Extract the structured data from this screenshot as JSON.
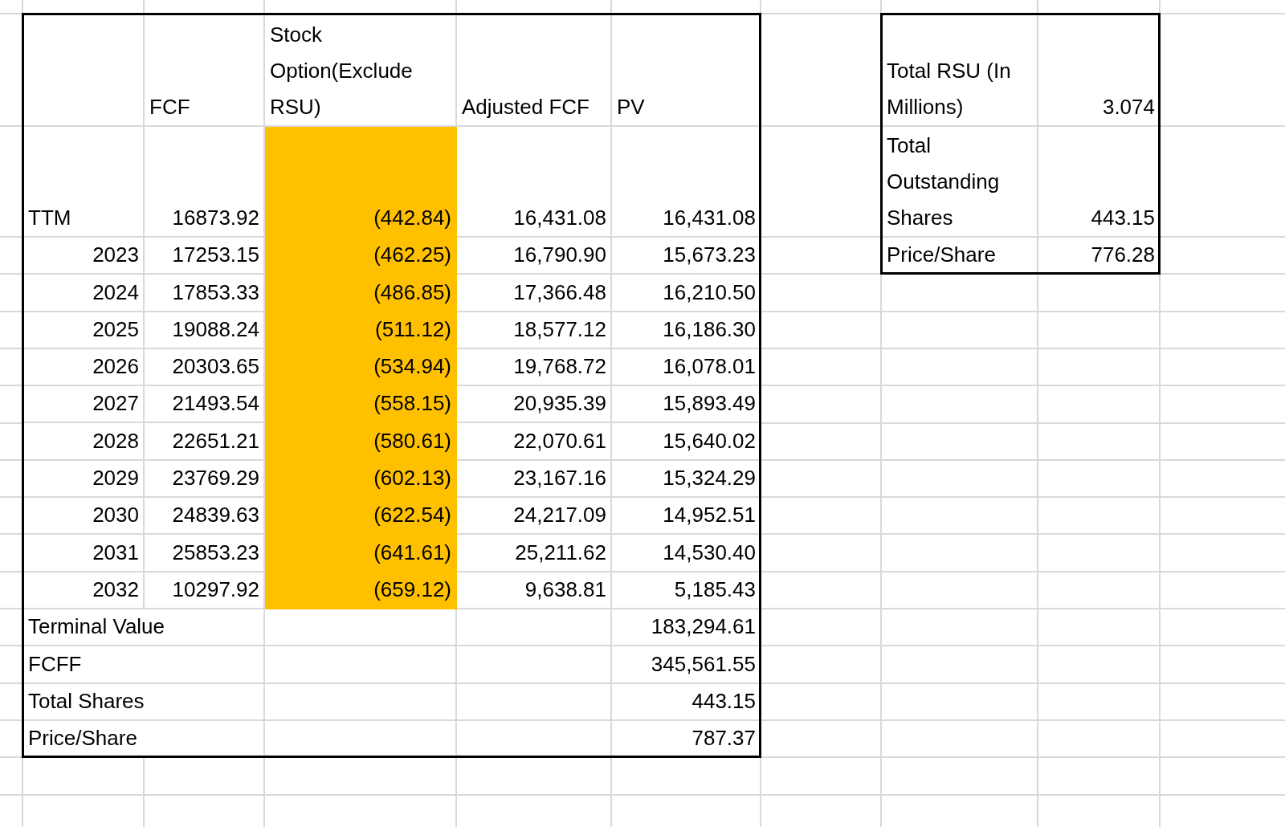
{
  "main_table": {
    "headers": [
      {
        "text": "FCF"
      },
      {
        "text": "Stock Option(Exclude RSU)"
      },
      {
        "text": "Adjusted FCF"
      },
      {
        "text": "PV"
      }
    ],
    "rows": [
      {
        "kind": "text",
        "label": "TTM",
        "fcf": "16873.92",
        "stock_option": "(442.84)",
        "stock_option_highlighted": true,
        "adjusted_fcf": "16,431.08",
        "pv": "16,431.08"
      },
      {
        "kind": "year",
        "label": "2023",
        "fcf": "17253.15",
        "stock_option": "(462.25)",
        "stock_option_highlighted": true,
        "adjusted_fcf": "16,790.90",
        "pv": "15,673.23"
      },
      {
        "kind": "year",
        "label": "2024",
        "fcf": "17853.33",
        "stock_option": "(486.85)",
        "stock_option_highlighted": true,
        "adjusted_fcf": "17,366.48",
        "pv": "16,210.50"
      },
      {
        "kind": "year",
        "label": "2025",
        "fcf": "19088.24",
        "stock_option": "(511.12)",
        "stock_option_highlighted": true,
        "adjusted_fcf": "18,577.12",
        "pv": "16,186.30"
      },
      {
        "kind": "year",
        "label": "2026",
        "fcf": "20303.65",
        "stock_option": "(534.94)",
        "stock_option_highlighted": true,
        "adjusted_fcf": "19,768.72",
        "pv": "16,078.01"
      },
      {
        "kind": "year",
        "label": "2027",
        "fcf": "21493.54",
        "stock_option": "(558.15)",
        "stock_option_highlighted": true,
        "adjusted_fcf": "20,935.39",
        "pv": "15,893.49"
      },
      {
        "kind": "year",
        "label": "2028",
        "fcf": "22651.21",
        "stock_option": "(580.61)",
        "stock_option_highlighted": true,
        "adjusted_fcf": "22,070.61",
        "pv": "15,640.02"
      },
      {
        "kind": "year",
        "label": "2029",
        "fcf": "23769.29",
        "stock_option": "(602.13)",
        "stock_option_highlighted": true,
        "adjusted_fcf": "23,167.16",
        "pv": "15,324.29"
      },
      {
        "kind": "year",
        "label": "2030",
        "fcf": "24839.63",
        "stock_option": "(622.54)",
        "stock_option_highlighted": true,
        "adjusted_fcf": "24,217.09",
        "pv": "14,952.51"
      },
      {
        "kind": "year",
        "label": "2031",
        "fcf": "25853.23",
        "stock_option": "(641.61)",
        "stock_option_highlighted": true,
        "adjusted_fcf": "25,211.62",
        "pv": "14,530.40"
      },
      {
        "kind": "year",
        "label": "2032",
        "fcf": "10297.92",
        "stock_option": "(659.12)",
        "stock_option_highlighted": true,
        "adjusted_fcf": "9,638.81",
        "pv": "5,185.43"
      }
    ],
    "summary": [
      {
        "label": "Terminal Value",
        "pv": "183,294.61"
      },
      {
        "label": "FCFF",
        "pv": "345,561.55"
      },
      {
        "label": "Total Shares",
        "pv": "443.15"
      },
      {
        "label": "Price/Share",
        "pv": "787.37"
      }
    ]
  },
  "side_table": {
    "rows": [
      {
        "label": "Total RSU (In Millions)",
        "value": "3.074"
      },
      {
        "label": "Total Outstanding Shares",
        "value": "443.15"
      },
      {
        "label": "Price/Share",
        "value": "776.28"
      }
    ]
  }
}
